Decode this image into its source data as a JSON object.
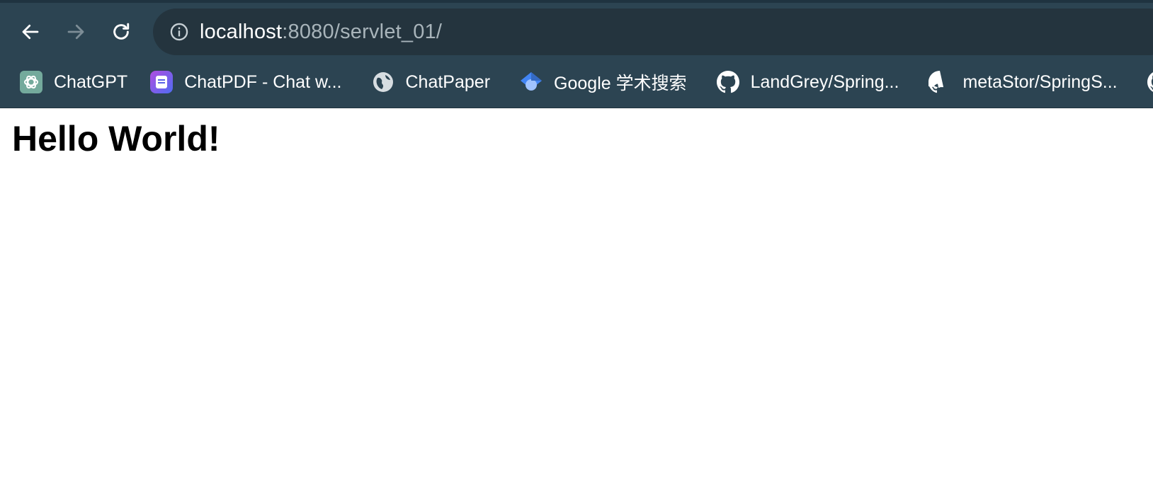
{
  "browser": {
    "address_bar": {
      "host": "localhost",
      "rest": ":8080/servlet_01/"
    },
    "nav": {
      "back_icon": "arrow-left-icon",
      "forward_icon": "arrow-right-icon",
      "reload_icon": "reload-icon",
      "site_info_icon": "info-icon"
    },
    "bookmarks": [
      {
        "label": "ChatGPT",
        "icon": "chatgpt-icon"
      },
      {
        "label": "ChatPDF - Chat w...",
        "icon": "chatpdf-icon"
      },
      {
        "label": "ChatPaper",
        "icon": "globe-icon"
      },
      {
        "label": "Google 学术搜索",
        "icon": "google-scholar-icon"
      },
      {
        "label": "LandGrey/Spring...",
        "icon": "github-icon"
      },
      {
        "label": "metaStor/SpringS...",
        "icon": "github-icon"
      },
      {
        "label": "",
        "icon": "github-icon"
      }
    ],
    "colors": {
      "chrome_background": "#2c4452",
      "omnibox_background": "#24343e",
      "text_primary": "#ffffff",
      "text_secondary": "#a8b4ba"
    }
  },
  "page": {
    "heading": "Hello World!"
  }
}
